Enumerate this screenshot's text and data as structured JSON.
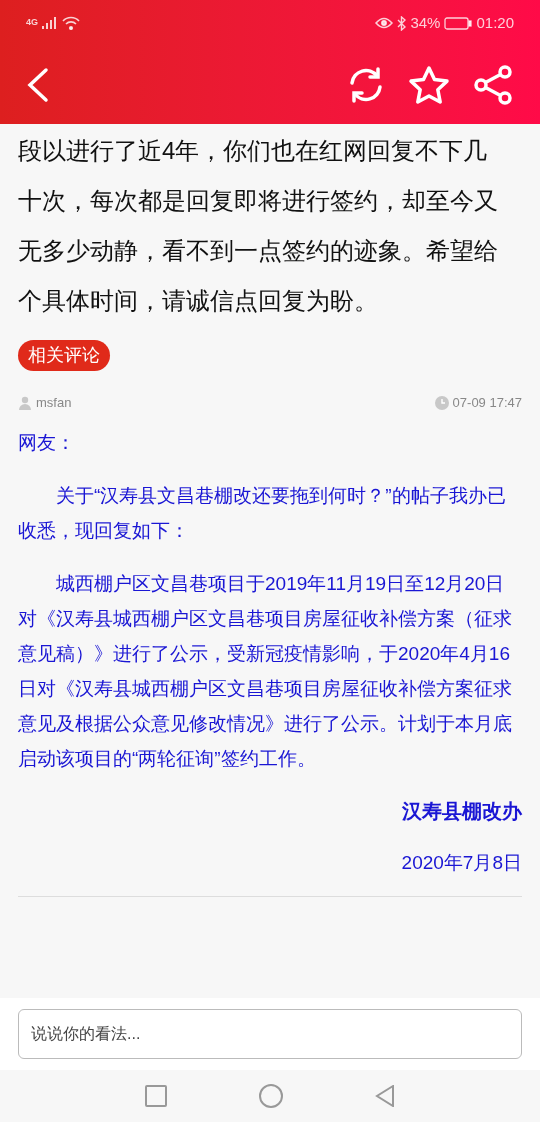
{
  "status_bar": {
    "network": "4G",
    "battery": "34%",
    "time": "01:20"
  },
  "post": {
    "text": "段以进行了近4年，你们也在红网回复不下几十次，每次都是回复即将进行签约，却至今又无多少动静，看不到一点签约的迹象。希望给个具体时间，请诚信点回复为盼。"
  },
  "section_badge": "相关评论",
  "comment": {
    "author": "msfan",
    "time": "07-09 17:47",
    "greeting": "网友：",
    "paragraphs": [
      "关于“汉寿县文昌巷棚改还要拖到何时？”的帖子我办已收悉，现回复如下：",
      "城西棚户区文昌巷项目于2019年11月19日至12月20日对《汉寿县城西棚户区文昌巷项目房屋征收补偿方案（征求意见稿）》进行了公示，受新冠疫情影响，于2020年4月16日对《汉寿县城西棚户区文昌巷项目房屋征收补偿方案征求意见及根据公众意见修改情况》进行了公示。计划于本月底启动该项目的“两轮征询”签约工作。"
    ],
    "signature": "汉寿县棚改办",
    "date": "2020年7月8日"
  },
  "comment_input": {
    "placeholder": "说说你的看法..."
  }
}
